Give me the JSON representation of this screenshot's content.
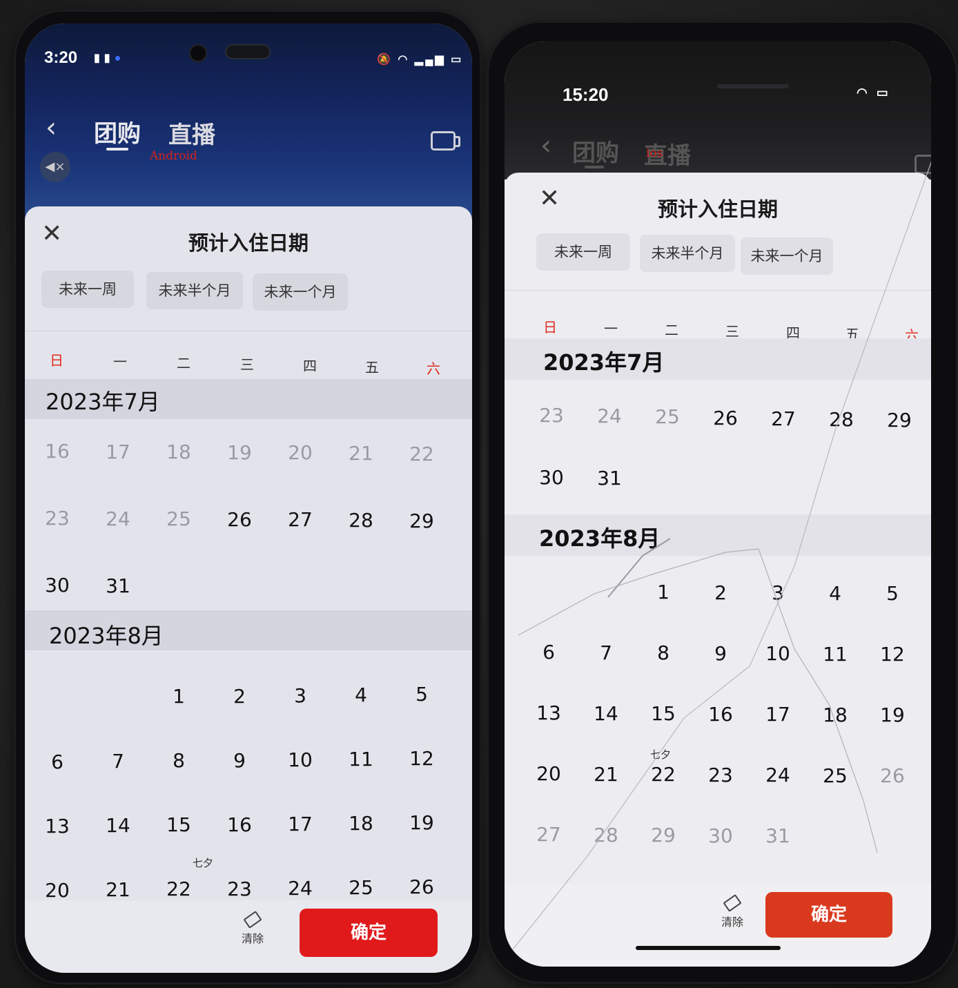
{
  "android": {
    "status_time": "3:20",
    "label": "Android",
    "tabs": [
      "团购",
      "直播"
    ],
    "sheet_title": "预计入住日期",
    "quick_chips": [
      "未来一周",
      "未来半个月",
      "未来一个月"
    ],
    "weekdays": [
      "日",
      "一",
      "二",
      "三",
      "四",
      "五",
      "六"
    ],
    "months": [
      {
        "label": "2023年7月",
        "rows": [
          [
            "16",
            "17",
            "18",
            "19",
            "20",
            "21",
            "22"
          ],
          [
            "23",
            "24",
            "25",
            "26",
            "27",
            "28",
            "29"
          ],
          [
            "30",
            "31",
            "",
            "",
            "",
            "",
            ""
          ]
        ],
        "past_count": 10
      },
      {
        "label": "2023年8月",
        "rows": [
          [
            "",
            "",
            "1",
            "2",
            "3",
            "4",
            "5"
          ],
          [
            "6",
            "7",
            "8",
            "9",
            "10",
            "11",
            "12"
          ],
          [
            "13",
            "14",
            "15",
            "16",
            "17",
            "18",
            "19"
          ],
          [
            "20",
            "21",
            "22",
            "23",
            "24",
            "25",
            "26"
          ]
        ],
        "past_count": 0
      }
    ],
    "festival": {
      "label": "七夕",
      "day": "22"
    },
    "clear_label": "清除",
    "confirm_label": "确定",
    "accent": "#e0191b"
  },
  "ios": {
    "status_time": "15:20",
    "label": "ios",
    "tabs": [
      "团购",
      "直播"
    ],
    "sheet_title": "预计入住日期",
    "quick_chips": [
      "未来一周",
      "未来半个月",
      "未来一个月"
    ],
    "weekdays": [
      "日",
      "一",
      "二",
      "三",
      "四",
      "五",
      "六"
    ],
    "months": [
      {
        "label": "2023年7月",
        "rows": [
          [
            "23",
            "24",
            "25",
            "26",
            "27",
            "28",
            "29"
          ],
          [
            "30",
            "31",
            "",
            "",
            "",
            "",
            ""
          ]
        ],
        "past_count": 3
      },
      {
        "label": "2023年8月",
        "rows": [
          [
            "",
            "",
            "1",
            "2",
            "3",
            "4",
            "5"
          ],
          [
            "6",
            "7",
            "8",
            "9",
            "10",
            "11",
            "12"
          ],
          [
            "13",
            "14",
            "15",
            "16",
            "17",
            "18",
            "19"
          ],
          [
            "20",
            "21",
            "22",
            "23",
            "24",
            "25",
            "26"
          ],
          [
            "27",
            "28",
            "29",
            "30",
            "31",
            "",
            ""
          ]
        ],
        "future_disabled_from": "26"
      }
    ],
    "festival": {
      "label": "七夕",
      "day": "22"
    },
    "clear_label": "清除",
    "confirm_label": "确定",
    "accent": "#d93a1e"
  }
}
